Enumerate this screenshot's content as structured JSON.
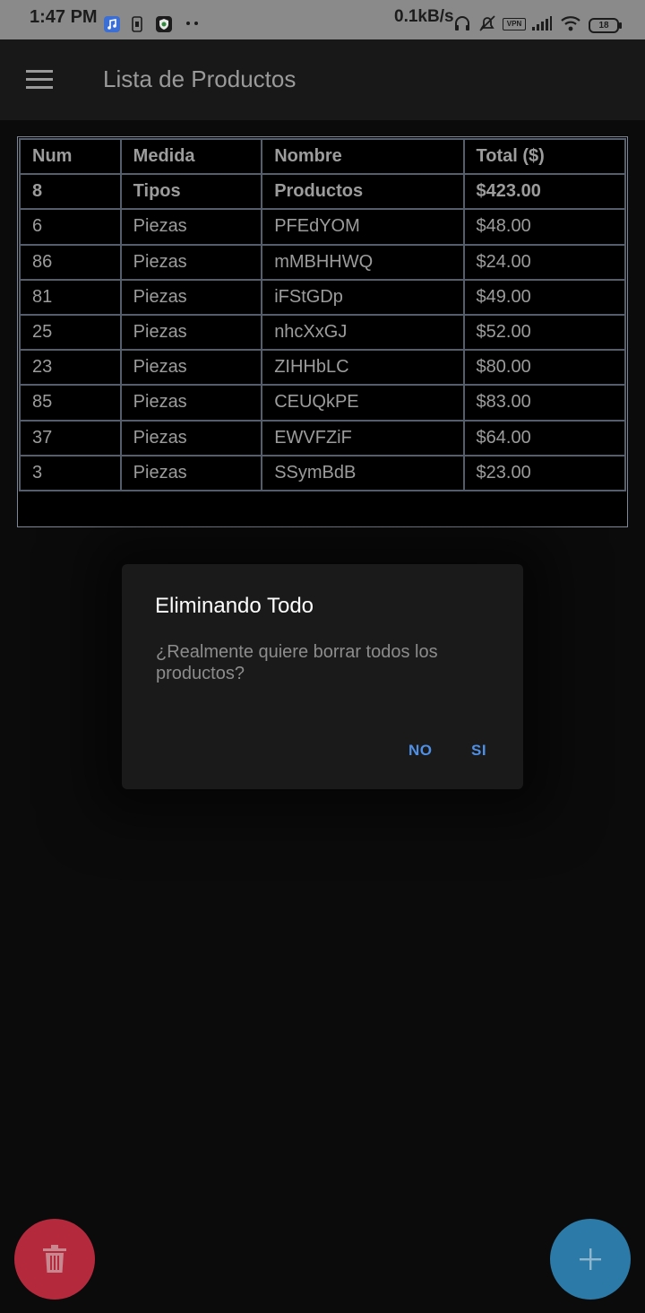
{
  "status_bar": {
    "time": "1:47 PM",
    "network_speed": "0.1kB/s",
    "vpn_label": "VPN",
    "battery": "18",
    "icons": [
      "music-notification-icon",
      "sim-icon",
      "shield-app-icon",
      "more-dots-icon",
      "headphones-icon",
      "mute-icon",
      "vpn-icon",
      "signal-icon",
      "wifi-icon",
      "battery-icon"
    ]
  },
  "appbar": {
    "title": "Lista de Productos",
    "menu_icon": "hamburger-menu-icon"
  },
  "table": {
    "headers": [
      "Num",
      "Medida",
      "Nombre",
      "Total ($)"
    ],
    "summary": [
      "8",
      "Tipos",
      "Productos",
      "$423.00"
    ],
    "rows": [
      [
        "6",
        "Piezas",
        "PFEdYOM",
        "$48.00"
      ],
      [
        "86",
        "Piezas",
        "mMBHHWQ",
        "$24.00"
      ],
      [
        "81",
        "Piezas",
        "iFStGDp",
        "$49.00"
      ],
      [
        "25",
        "Piezas",
        "nhcXxGJ",
        "$52.00"
      ],
      [
        "23",
        "Piezas",
        "ZIHHbLC",
        "$80.00"
      ],
      [
        "85",
        "Piezas",
        "CEUQkPE",
        "$83.00"
      ],
      [
        "37",
        "Piezas",
        "EWVFZiF",
        "$64.00"
      ],
      [
        "3",
        "Piezas",
        "SSymBdB",
        "$23.00"
      ]
    ]
  },
  "dialog": {
    "title": "Eliminando Todo",
    "message": "¿Realmente quiere borrar todos los productos?",
    "no_label": "NO",
    "yes_label": "SI"
  },
  "fabs": {
    "delete_icon": "trash-icon",
    "add_icon": "plus-icon"
  },
  "colors": {
    "background": "#0b0b0b",
    "appbar": "#181818",
    "dialog_bg": "#1a1a1a",
    "accent_button_text": "#4f8fe6",
    "fab_delete": "#b42a3c",
    "fab_add": "#2c7aa8"
  }
}
